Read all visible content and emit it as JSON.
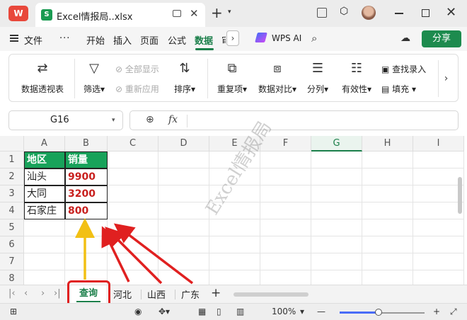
{
  "titlebar": {
    "app_logo": "W",
    "doc_icon_letter": "S",
    "doc_title": "Excel情报局..xlsx"
  },
  "menu": {
    "file": "文件",
    "items": [
      "开始",
      "插入",
      "页面",
      "公式",
      "数据",
      "审"
    ],
    "active": "数据",
    "wps_ai": "WPS AI",
    "share": "分享"
  },
  "ribbon": {
    "pivot": "数据透视表",
    "filter": "筛选",
    "show_all": "全部显示",
    "reapply": "重新应用",
    "sort": "排序",
    "duplicates": "重复项",
    "compare": "数据对比",
    "split": "分列",
    "validity": "有效性",
    "lookup": "查找录入",
    "fill": "填充"
  },
  "formula_bar": {
    "name_box": "G16",
    "fx": "fx",
    "content": ""
  },
  "grid": {
    "columns": [
      "A",
      "B",
      "C",
      "D",
      "E",
      "F",
      "G",
      "H",
      "I"
    ],
    "selected_column": "G",
    "rows": [
      "1",
      "2",
      "3",
      "4",
      "5",
      "6",
      "7",
      "8"
    ],
    "data": [
      [
        "地区",
        "销量"
      ],
      [
        "汕头",
        "9900"
      ],
      [
        "大同",
        "3200"
      ],
      [
        "石家庄",
        "800"
      ]
    ]
  },
  "watermark": "Excel情报局",
  "sheets": {
    "tabs": [
      "查询",
      "河北",
      "山西",
      "广东"
    ],
    "active": "查询"
  },
  "status": {
    "zoom": "100%"
  },
  "colors": {
    "accent": "#1b7f4a",
    "header_fill": "#18a25a",
    "value_red": "#c8201e",
    "annotation_red": "#e02020",
    "annotation_yellow": "#f2c014"
  }
}
